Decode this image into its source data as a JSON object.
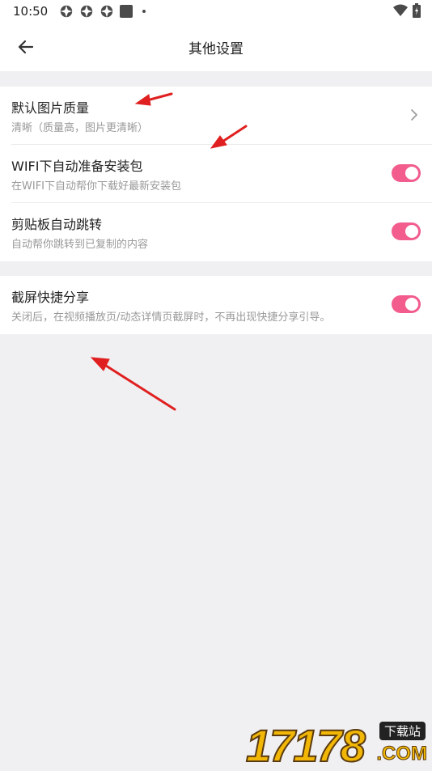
{
  "status_bar": {
    "time": "10:50",
    "icons": [
      "app-notification-icon",
      "app-notification-icon",
      "app-notification-icon",
      "square-app-icon",
      "dot-icon"
    ],
    "right_icons": [
      "wifi-icon",
      "battery-charging-icon"
    ]
  },
  "header": {
    "back_icon": "arrow-left-icon",
    "title": "其他设置"
  },
  "settings": {
    "group1": [
      {
        "title": "默认图片质量",
        "subtitle": "清晰（质量高，图片更清晰）",
        "control": "chevron"
      },
      {
        "title": "WIFI下自动准备安装包",
        "subtitle": "在WIFI下自动帮你下载好最新安装包",
        "control": "toggle",
        "on": true
      },
      {
        "title": "剪贴板自动跳转",
        "subtitle": "自动帮你跳转到已复制的内容",
        "control": "toggle",
        "on": true
      }
    ],
    "group2": [
      {
        "title": "截屏快捷分享",
        "subtitle": "关闭后，在视频播放页/动态详情页截屏时，不再出现快捷分享引导。",
        "control": "toggle",
        "on": true
      }
    ]
  },
  "colors": {
    "accent": "#f25d8e",
    "background": "#f0f0f2",
    "annotation_arrow": "#e02020"
  },
  "watermark": {
    "digits": "17178",
    "badge": "下载站",
    "suffix": ".COM"
  }
}
